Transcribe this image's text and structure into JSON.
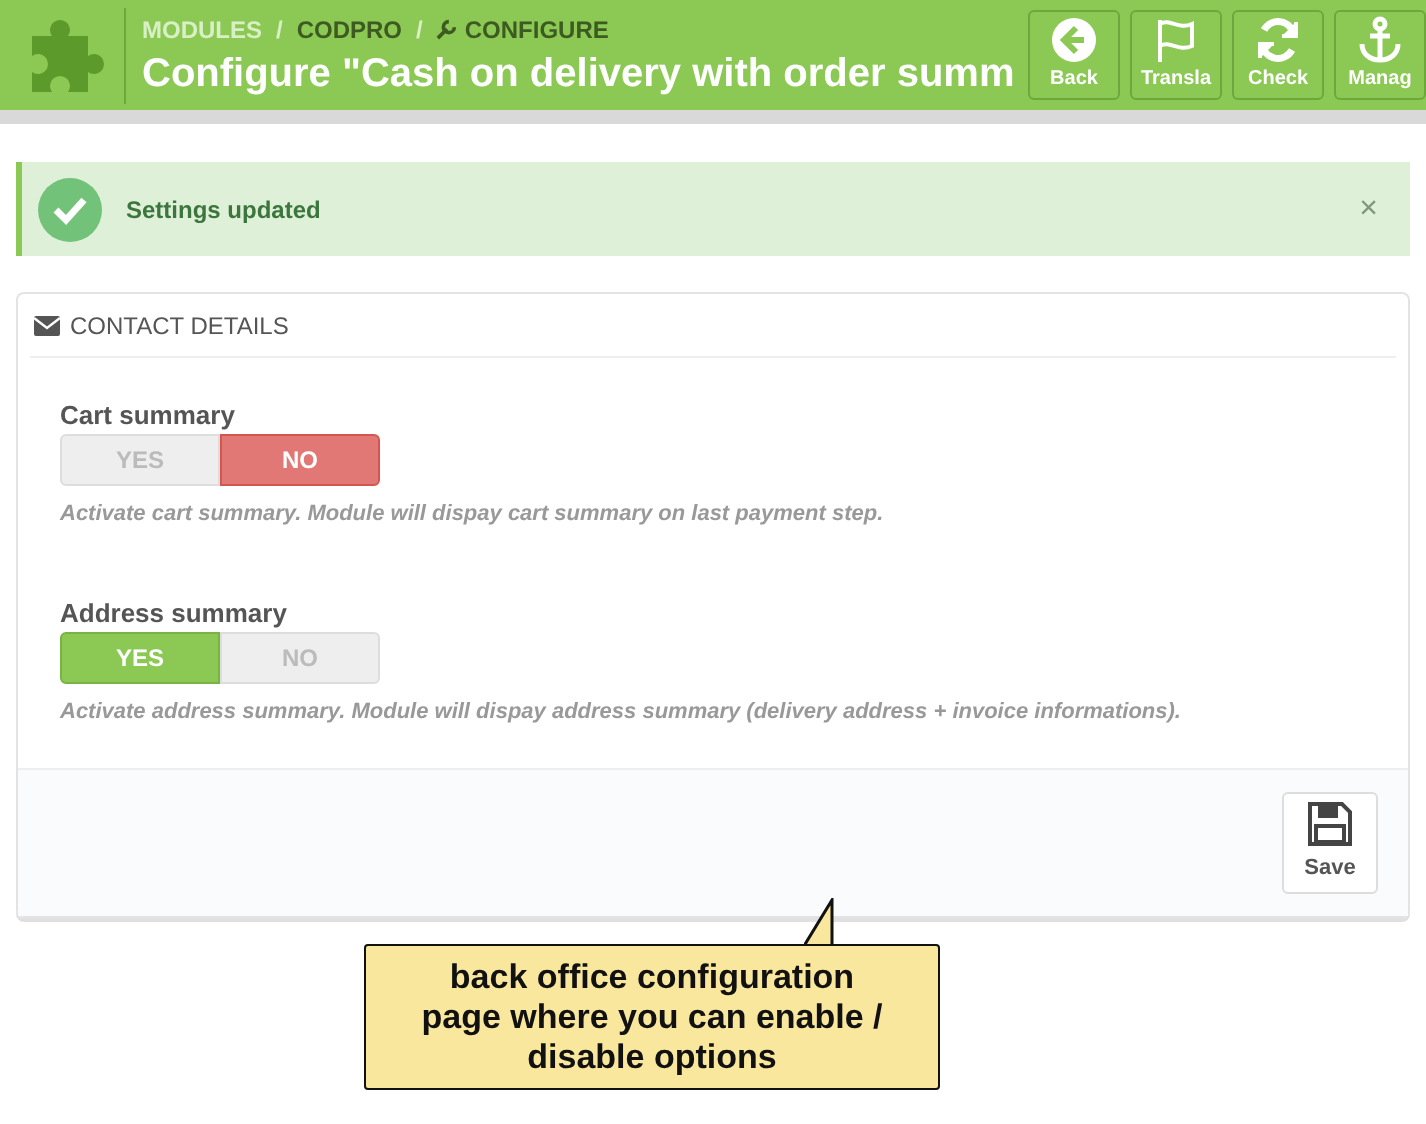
{
  "header": {
    "breadcrumb": [
      {
        "label": "MODULES",
        "current": false
      },
      {
        "label": "/",
        "current": false
      },
      {
        "label": "CODPRO",
        "current": true
      },
      {
        "label": "/",
        "current": false
      },
      {
        "label": "CONFIGURE",
        "current": true
      }
    ],
    "title": "Configure \"Cash on delivery with order summ",
    "toolbar": [
      {
        "kind": "back",
        "label": "Back"
      },
      {
        "kind": "translate",
        "label": "Transla"
      },
      {
        "kind": "check",
        "label": "Check"
      },
      {
        "kind": "manage",
        "label": "Manag"
      }
    ]
  },
  "alert": {
    "message": "Settings updated",
    "close": "×"
  },
  "panel": {
    "title": "CONTACT DETAILS",
    "fields": [
      {
        "label": "Cart summary",
        "options": [
          {
            "label": "YES",
            "kind": "yes",
            "selected": false
          },
          {
            "label": "NO",
            "kind": "no",
            "selected": true
          }
        ],
        "help": "Activate cart summary. Module will dispay cart summary on last payment step."
      },
      {
        "label": "Address summary",
        "options": [
          {
            "label": "YES",
            "kind": "yes",
            "selected": true
          },
          {
            "label": "NO",
            "kind": "no",
            "selected": false
          }
        ],
        "help": "Activate address summary. Module will dispay address summary (delivery address + invoice informations)."
      }
    ],
    "save": "Save"
  },
  "callout": {
    "text": "back office configuration page where you can enable / disable options"
  }
}
